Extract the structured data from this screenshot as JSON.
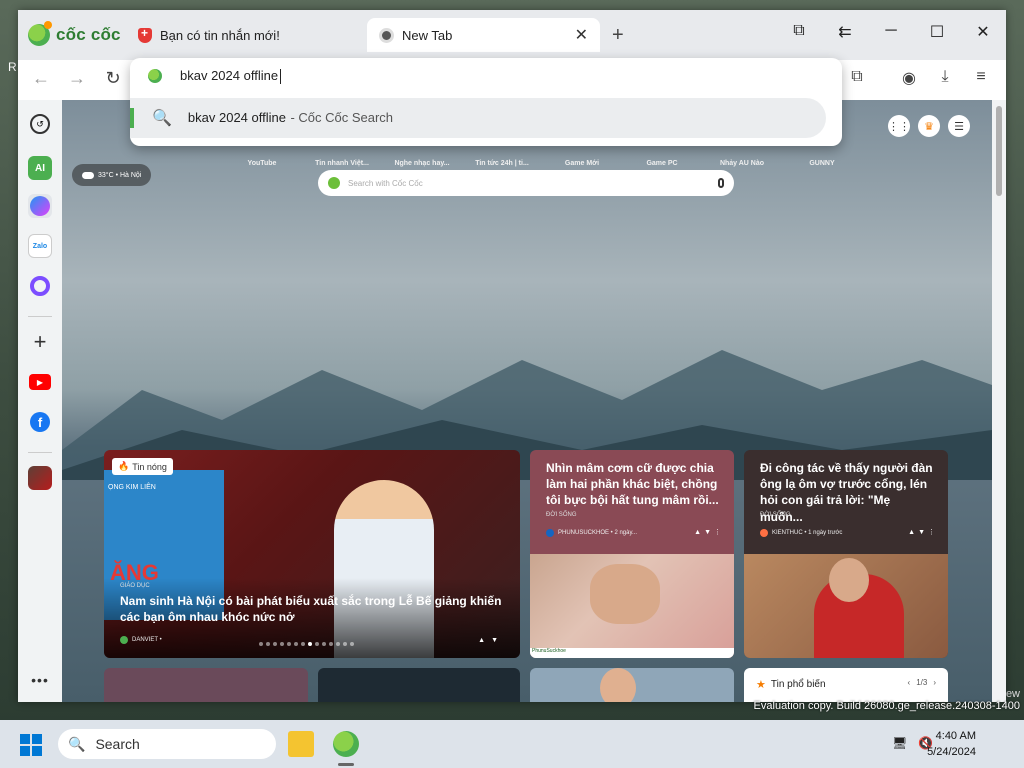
{
  "window": {
    "logo_text": "cốc cốc",
    "tabs": [
      {
        "label": "Bạn có tin nhắn mới!",
        "icon": "shield-icon",
        "active": false
      },
      {
        "label": "New Tab",
        "icon": "coccoc-icon",
        "active": true
      }
    ],
    "close_tab_glyph": "✕",
    "new_tab_glyph": "+",
    "controls": {
      "cast": "⧉",
      "tabs_search": "⇇",
      "minimize": "─",
      "maximize": "☐",
      "close": "✕"
    }
  },
  "navbar": {
    "back": "←",
    "forward": "→",
    "reload": "↻",
    "extensions": "⧉",
    "profile": "◉",
    "download": "⤓",
    "menu": "≡"
  },
  "omnibox": {
    "typed_text": "bkav 2024 offline",
    "suggestion_query": "bkav 2024 offline",
    "suggestion_source": "- Cốc Cốc Search"
  },
  "new_tab_page": {
    "quick_links": [
      "YouTube",
      "Tin nhanh Việt...",
      "Nghe nhạc hay...",
      "Tin tức 24h | ti...",
      "Game Mới",
      "Game PC",
      "Nhảy AU Nào",
      "GUNNY"
    ],
    "weather": "33°C • Hà Nội",
    "search_placeholder": "Search with Cốc Cốc",
    "hero": {
      "badge": "Tin nóng",
      "category": "GIÁO DỤC",
      "title": "Nam sinh Hà Nội có bài phát biểu xuất sắc trong Lễ Bế giảng khiến các bạn ôm nhau khóc nức nở",
      "source": "DANVIET •",
      "board_text": "ĂNG",
      "board_label": "ỌNG KIM LIÊN"
    },
    "card2": {
      "title": "Nhìn mâm cơm cữ được chia làm hai phần khác biệt, chồng tôi bực bội hất tung mâm rồi...",
      "category": "ĐỜI SỐNG",
      "source": "PHUNUSUCKHOE • 2 ngày...",
      "brand_strip": "PhunuSuckhoe"
    },
    "card3": {
      "title": "Đi công tác về thấy người đàn ông lạ ôm vợ trước cổng, lén hỏi con gái trả lời: \"Mẹ muốn...",
      "category": "ĐỜI SỐNG",
      "source": "KIENTHUC • 1 ngày trước"
    },
    "popular": {
      "label": "Tin phổ biến",
      "pager": "1/3"
    }
  },
  "taskbar": {
    "search_label": "Search",
    "time": "4:40 AM",
    "date": "5/24/2024"
  },
  "watermark": {
    "evaluation": "Evaluation copy. Build 26080.ge_release.240308-1400"
  },
  "colors": {
    "brand_green": "#4caf50",
    "hot_badge_flame": "#ff5722",
    "taskbar": "#dde3ea"
  }
}
